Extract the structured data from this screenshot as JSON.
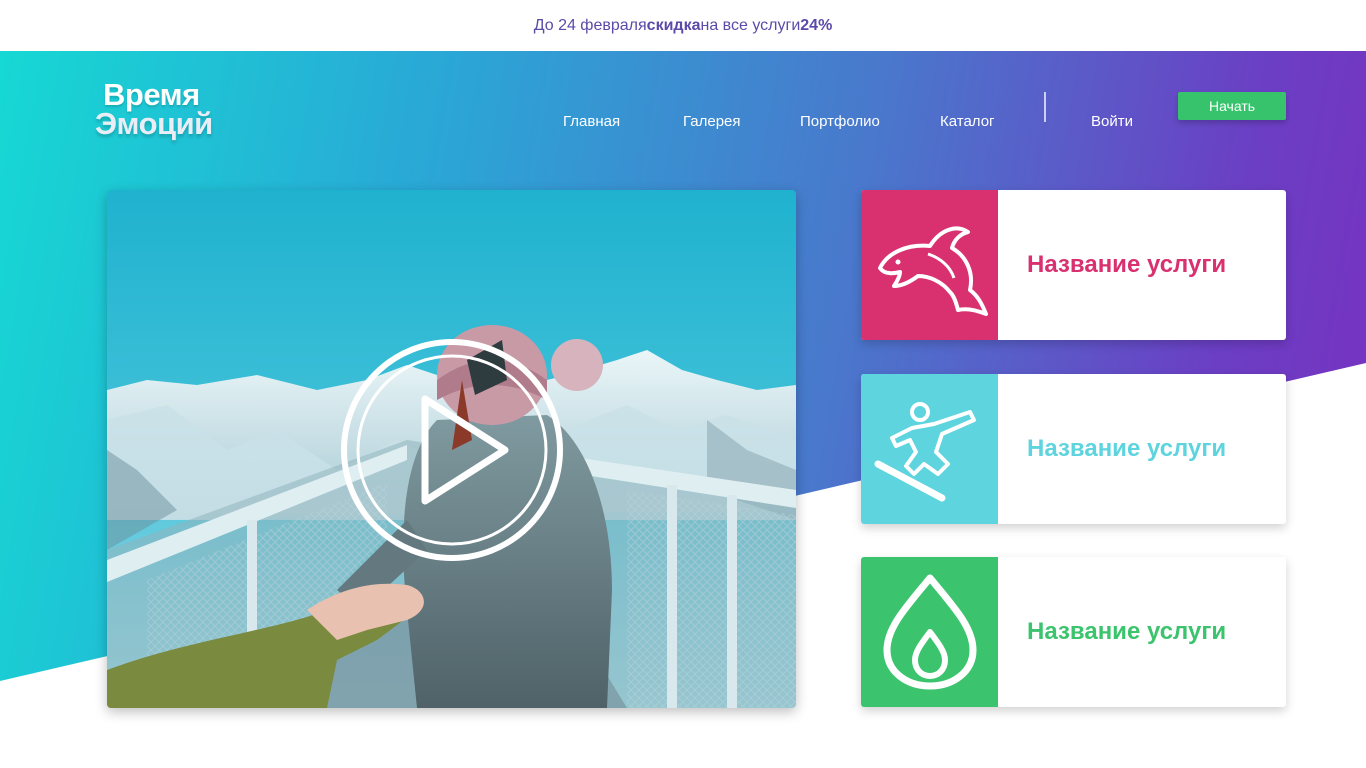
{
  "promo": {
    "prefix": "До 24 февраля ",
    "bold1": "скидка",
    "middle": " на все услуги ",
    "bold2": "24%"
  },
  "logo": {
    "line1": "Время",
    "line2": "Эмоций"
  },
  "nav": {
    "items": [
      {
        "label": "Главная"
      },
      {
        "label": "Галерея"
      },
      {
        "label": "Портфолио"
      },
      {
        "label": "Каталог"
      }
    ],
    "login": "Войти",
    "start": "Начать"
  },
  "video": {
    "icon": "play-icon"
  },
  "services": [
    {
      "title": "Название услуги",
      "icon": "dolphin-icon",
      "color": "#d9306f"
    },
    {
      "title": "Название услуги",
      "icon": "snowboarder-icon",
      "color": "#5dd4de"
    },
    {
      "title": "Название услуги",
      "icon": "flame-icon",
      "color": "#3bc46d"
    }
  ],
  "colors": {
    "gradient_start": "#16d8d4",
    "gradient_end": "#7a2fc0",
    "cta": "#36c36c",
    "promo_text": "#5b4aa8"
  }
}
